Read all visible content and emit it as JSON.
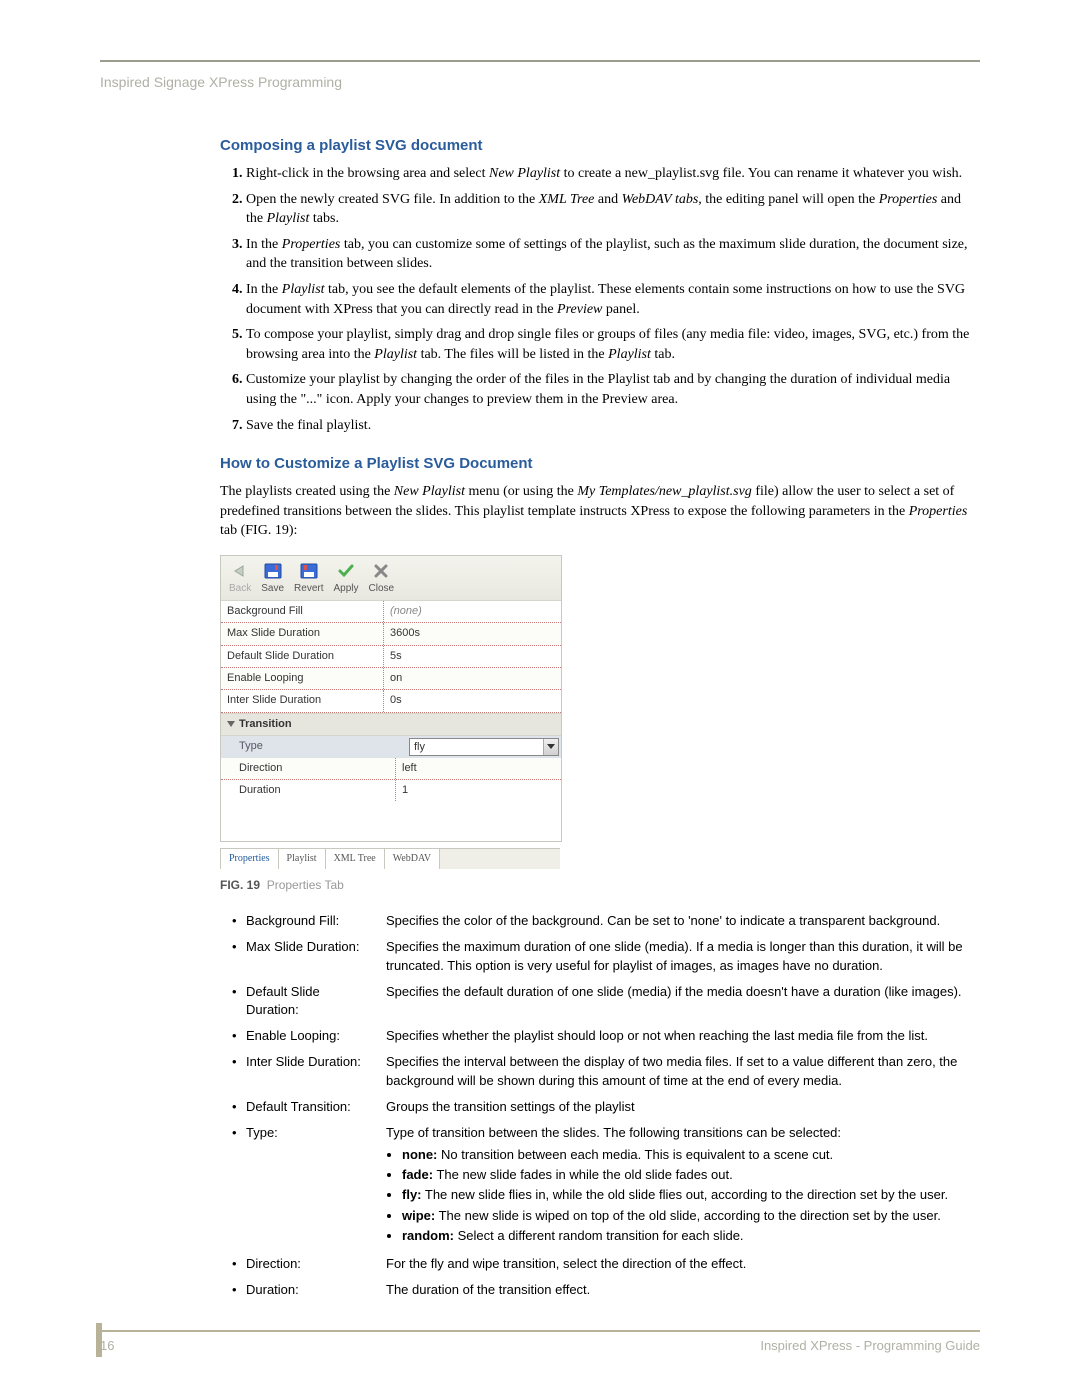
{
  "running_head": "Inspired Signage XPress Programming",
  "section1_title": "Composing a playlist SVG document",
  "steps": [
    {
      "pre": "Right-click in the browsing area and select ",
      "em1": "New Playlist",
      "post": " to create a new_playlist.svg file. You can rename it whatever you wish."
    },
    {
      "pre": "Open the newly created SVG file. In addition to the ",
      "em1": "XML Tree",
      "mid1": " and ",
      "em2": "WebDAV tabs",
      "mid2": ", the editing panel will open the ",
      "em3": "Properties",
      "mid3": " and the ",
      "em4": "Playlist",
      "post": " tabs."
    },
    {
      "pre": "In the ",
      "em1": "Properties",
      "post": " tab, you can customize some of settings of the playlist, such as the maximum slide duration, the document size, and the transition between slides."
    },
    {
      "pre": "In the ",
      "em1": "Playlist",
      "mid1": " tab, you see the default elements of the playlist. These elements contain some instructions on how to use the SVG document with XPress that you can directly read in the ",
      "em2": "Preview",
      "post": " panel."
    },
    {
      "pre": "To compose your playlist, simply drag and drop single files or groups of files (any media file: video, images, SVG, etc.) from the browsing area into the ",
      "em1": "Playlist",
      "mid1": " tab. The files will be listed in the ",
      "em2": "Playlist",
      "post": " tab."
    },
    {
      "pre": "Customize your playlist by changing the order of the files in the Playlist tab and by changing the duration of individual media using the \"...\" icon. Apply your changes to preview them in the Preview area.",
      "em1": "",
      "post": ""
    },
    {
      "pre": "Save the final playlist.",
      "em1": "",
      "post": ""
    }
  ],
  "section2_title": "How to Customize a Playlist SVG Document",
  "intro_p": {
    "p1": "The playlists created using the ",
    "em1": "New Playlist",
    "p2": " menu (or using the ",
    "em2": "My Templates/new_playlist.svg",
    "p3": " file) allow the user to select a set of predefined transitions between the slides. This playlist template instructs XPress to expose the following parameters in the ",
    "em3": "Properties",
    "p4": " tab (FIG. 19):"
  },
  "toolbar": {
    "back": "Back",
    "save": "Save",
    "revert": "Revert",
    "apply": "Apply",
    "close": "Close"
  },
  "grid": {
    "bg_fill_lbl": "Background Fill",
    "bg_fill_val": "(none)",
    "max_dur_lbl": "Max Slide Duration",
    "max_dur_val": "3600s",
    "def_dur_lbl": "Default Slide Duration",
    "def_dur_val": "5s",
    "loop_lbl": "Enable Looping",
    "loop_val": "on",
    "inter_lbl": "Inter Slide Duration",
    "inter_val": "0s",
    "trans_hdr": "Transition",
    "type_lbl": "Type",
    "type_val": "fly",
    "dir_lbl": "Direction",
    "dir_val": "left",
    "dur_lbl": "Duration",
    "dur_val": "1"
  },
  "panel_tabs": {
    "properties": "Properties",
    "playlist": "Playlist",
    "xml": "XML Tree",
    "webdav": "WebDAV"
  },
  "fig_label": "FIG. 19",
  "fig_caption": "Properties Tab",
  "defs": [
    {
      "term": "Background Fill:",
      "desc": "Specifies the color of the background. Can be set to 'none' to indicate a transparent background."
    },
    {
      "term": "Max Slide Duration:",
      "desc": "Specifies the maximum duration of one slide (media). If a media is longer than this duration, it will be truncated. This option is very useful for playlist of images, as images have no duration."
    },
    {
      "term": "Default Slide Duration:",
      "desc": " Specifies the default duration of one slide (media) if the media doesn't have a duration (like images)."
    },
    {
      "term": "Enable Looping:",
      "desc": "Specifies whether the playlist should loop or not when reaching the last media file from the list."
    },
    {
      "term": "Inter Slide Duration:",
      "desc": "Specifies the interval between the display of two media files. If set to a value different than zero, the background will be shown during this amount of time at the end of every media."
    },
    {
      "term": "Default Transition:",
      "desc": "Groups the transition settings of the playlist"
    },
    {
      "term": "Type:",
      "desc": "Type of transition between the slides. The following transitions can be selected:"
    },
    {
      "term": "Direction:",
      "desc": "For the fly and wipe transition, select the direction of the effect."
    },
    {
      "term": "Duration:",
      "desc": "The duration of the transition effect."
    }
  ],
  "type_subs": [
    {
      "b": "none:",
      "t": " No transition between each media. This is equivalent to a scene cut."
    },
    {
      "b": "fade:",
      "t": " The new slide fades in while the old slide fades out."
    },
    {
      "b": "fly:",
      "t": " The new slide flies in, while the old slide flies out, according to the direction set by the user."
    },
    {
      "b": "wipe:",
      "t": " The new slide is wiped on top of the old slide, according to the direction set by the user."
    },
    {
      "b": "random:",
      "t": " Select a different random transition for each slide."
    }
  ],
  "footer_page": "16",
  "footer_title": "Inspired XPress - Programming Guide"
}
